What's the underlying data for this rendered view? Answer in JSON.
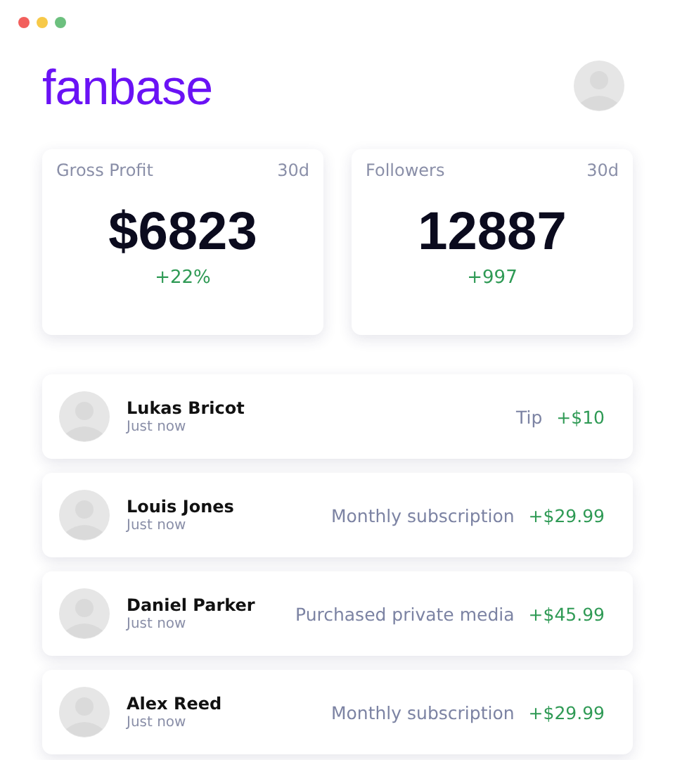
{
  "brand": {
    "logo": "fanbase"
  },
  "stats": [
    {
      "label": "Gross Profit",
      "period": "30d",
      "value": "$6823",
      "change": "+22%"
    },
    {
      "label": "Followers",
      "period": "30d",
      "value": "12887",
      "change": "+997"
    }
  ],
  "activity": [
    {
      "name": "Lukas Bricot",
      "time": "Just now",
      "description": "Tip",
      "amount": "+$10"
    },
    {
      "name": "Louis Jones",
      "time": "Just now",
      "description": "Monthly subscription",
      "amount": "+$29.99"
    },
    {
      "name": "Daniel Parker",
      "time": "Just now",
      "description": "Purchased private media",
      "amount": "+$45.99"
    },
    {
      "name": "Alex Reed",
      "time": "Just now",
      "description": "Monthly subscription",
      "amount": "+$29.99"
    }
  ]
}
